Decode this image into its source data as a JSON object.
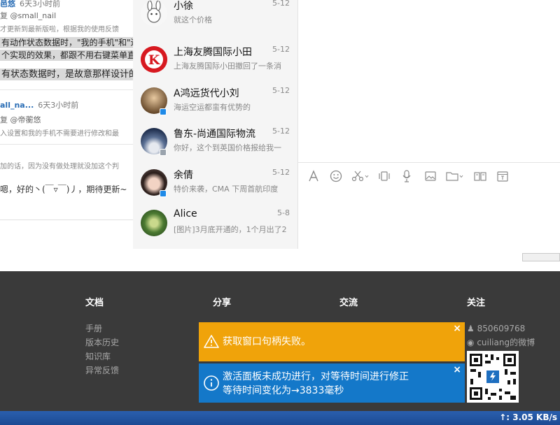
{
  "background_page": {
    "row1_user_partial": "邑悠",
    "row1_time": "6天3小时前",
    "row1_reply": "复 @small_nail",
    "row1_line1": "才更新到最新版啦，根据我的使用反馈",
    "row1_line2": "有动作状态数据时，\"我的手机\"和\"进入",
    "row1_line3": "个实现的效果，都跟不用右键菜单直接",
    "row1_line4": "有状态数据时，是故意那样设计的",
    "row2_user": "all_na...",
    "row2_time": "6天3小时前",
    "row2_reply": "复 @帝蘅悠",
    "row2_line1": "入设置和我的手机不需要进行修改和最",
    "row3_line1": "加的话，因为没有做处理就没加这个判",
    "row3_line2": "嗯，好的丶(￣▿￣)丿，期待更新~"
  },
  "chat_list": [
    {
      "name": "小徐",
      "date": "5-12",
      "preview": "就这个价格",
      "has_badge": false
    },
    {
      "name": "上海友腾国际小田",
      "date": "5-12",
      "preview": "上海友腾国际小田撤回了一条消",
      "has_badge": false
    },
    {
      "name": "A鸿远货代小刘",
      "date": "5-12",
      "preview": "海运空运都蛮有优势的",
      "has_badge": true
    },
    {
      "name": "鲁东-尚通国际物流",
      "date": "5-12",
      "preview": "你好，这个到英国价格报给我一",
      "has_badge": true
    },
    {
      "name": "余倩",
      "date": "5-12",
      "preview": "特价来袭，CMA 下周首航印度",
      "has_badge": true
    },
    {
      "name": "Alice",
      "date": "5-8",
      "preview": "[图片]3月底开通的，1个月出了2",
      "has_badge": false
    }
  ],
  "toolbar_icons": [
    "font-icon",
    "emoji-icon",
    "scissors-icon",
    "shake-icon",
    "microphone-icon",
    "image-icon",
    "folder-icon",
    "favorites-icon",
    "history-icon"
  ],
  "footer": {
    "col_docs": {
      "title": "文档",
      "links": [
        "手册",
        "版本历史",
        "知识库",
        "异常反馈"
      ]
    },
    "col_share": {
      "title": "分享"
    },
    "col_talk": {
      "title": "交流"
    },
    "col_follow": {
      "title": "关注",
      "qq": "850609768",
      "weibo": "cuiliang的微博"
    }
  },
  "toasts": {
    "warning": {
      "text": "获取窗口句柄失败。",
      "close": "×",
      "color": "#f0a30a"
    },
    "info": {
      "line1": "激活面板未成功进行，对等待时间进行修正",
      "line2": "等待时间变化为→3833毫秒",
      "close": "×",
      "color": "#1478c9"
    }
  },
  "taskbar": {
    "net_speed": "↑: 3.05 KB/s"
  }
}
